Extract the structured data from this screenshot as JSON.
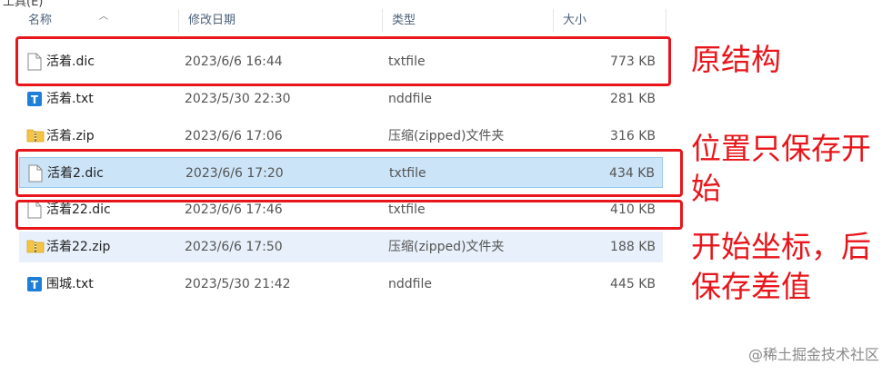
{
  "window": {
    "path_fragment": "工具(E)"
  },
  "columns": {
    "name": "名称",
    "modified": "修改日期",
    "type": "类型",
    "size": "大小"
  },
  "files": [
    {
      "name": "活着.dic",
      "modified": "2023/6/6 16:44",
      "type": "txtfile",
      "size": "773 KB",
      "icon": "text-file-icon"
    },
    {
      "name": "活着.txt",
      "modified": "2023/5/30 22:30",
      "type": "nddfile",
      "size": "281 KB",
      "icon": "ndd-file-icon"
    },
    {
      "name": "活着.zip",
      "modified": "2023/6/6 17:06",
      "type": "压缩(zipped)文件夹",
      "size": "316 KB",
      "icon": "zip-folder-icon"
    },
    {
      "name": "活着2.dic",
      "modified": "2023/6/6 17:20",
      "type": "txtfile",
      "size": "434 KB",
      "icon": "text-file-icon"
    },
    {
      "name": "活着22.dic",
      "modified": "2023/6/6 17:46",
      "type": "txtfile",
      "size": "410 KB",
      "icon": "text-file-icon"
    },
    {
      "name": "活着22.zip",
      "modified": "2023/6/6 17:50",
      "type": "压缩(zipped)文件夹",
      "size": "188 KB",
      "icon": "zip-folder-icon"
    },
    {
      "name": "围城.txt",
      "modified": "2023/5/30 21:42",
      "type": "nddfile",
      "size": "445 KB",
      "icon": "ndd-file-icon"
    }
  ],
  "annotations": {
    "note1": "原结构",
    "note2_line1": "位置只保存开",
    "note2_line2": "始",
    "note3_line1": "开始坐标，后",
    "note3_line2": "保存差值"
  },
  "watermark": "@稀土掘金技术社区",
  "colors": {
    "annotation_red": "#e8161b",
    "selection_blue": "#cce4f7",
    "hover_blue": "#e8f1fb"
  }
}
